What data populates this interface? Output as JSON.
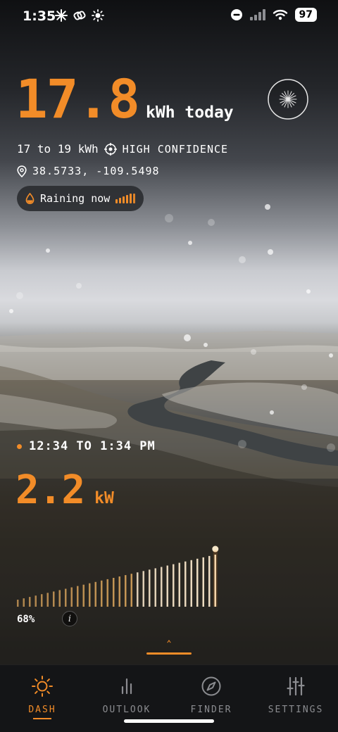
{
  "status_bar": {
    "time": "1:35",
    "battery": "97"
  },
  "hero": {
    "energy_value": "17.8",
    "energy_unit": "kWh today"
  },
  "forecast": {
    "range": "17 to 19 kWh",
    "confidence": "HIGH CONFIDENCE",
    "coordinates": "38.5733, -109.5498"
  },
  "weather_chip": {
    "label": "Raining now"
  },
  "window": {
    "label": "12:34 TO 1:34 PM"
  },
  "power": {
    "value": "2.2",
    "unit": "kW"
  },
  "capacity": {
    "percent_label": "68%",
    "percent": 68,
    "info_icon": "i",
    "bar_count": 34
  },
  "tabs": [
    {
      "label": "DASH",
      "icon": "sun-icon",
      "active": true
    },
    {
      "label": "OUTLOOK",
      "icon": "bar-chart-icon",
      "active": false
    },
    {
      "label": "FINDER",
      "icon": "compass-icon",
      "active": false
    },
    {
      "label": "SETTINGS",
      "icon": "sliders-icon",
      "active": false
    }
  ],
  "colors": {
    "accent": "#f28c28",
    "text": "#ffffff",
    "tab_inactive": "#8b8c90",
    "tabbar_bg": "#141517"
  }
}
